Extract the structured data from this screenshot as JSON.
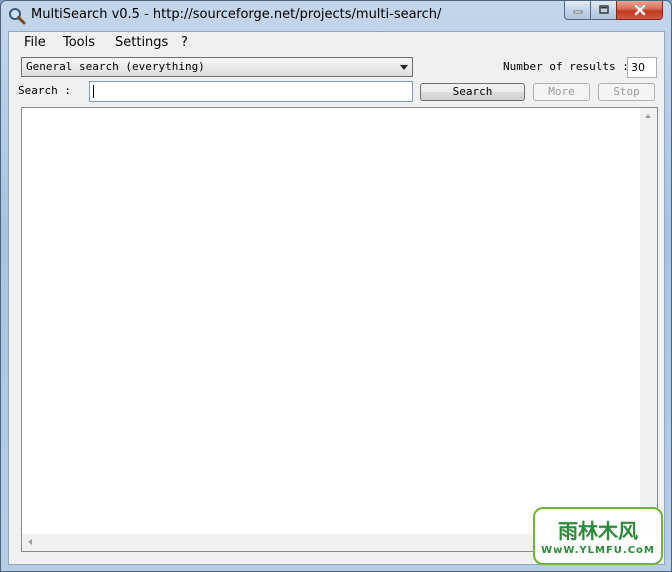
{
  "window": {
    "title": "MultiSearch v0.5 - http://sourceforge.net/projects/multi-search/"
  },
  "menu": {
    "items": [
      {
        "label": "File"
      },
      {
        "label": "Tools"
      },
      {
        "label": "Settings"
      },
      {
        "label": "?"
      }
    ]
  },
  "search_type": {
    "selected": "General search (everything)"
  },
  "results_count": {
    "label": "Number of results :",
    "value": "30"
  },
  "search": {
    "label": "Search :",
    "value": ""
  },
  "buttons": {
    "search": "Search",
    "more": "More",
    "stop": "Stop"
  },
  "watermark": {
    "main": "雨林木风",
    "sub": "WwW.YLMFU.CoM"
  },
  "colors": {
    "close_button": "#c23a22",
    "watermark_green": "#2c8a3a"
  }
}
